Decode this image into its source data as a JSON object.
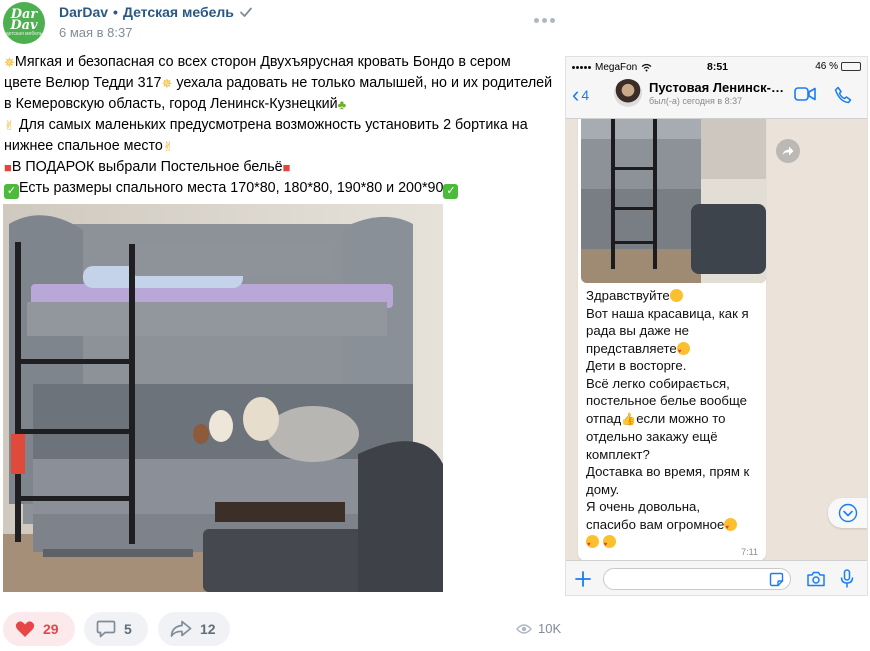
{
  "post": {
    "author_name": "DarDav",
    "separator": "•",
    "group_name": "Детская мебель",
    "avatar_logo_top": "Dar",
    "avatar_logo_bottom": "Dav",
    "avatar_logo_sub": "детская мебель",
    "date": "6 мая в 8:37",
    "text": {
      "l1": "Мягкая и безопасная со всех сторон Двухъярусная кровать Бондо в сером",
      "l2a": "цвете Велюр Тедди 317",
      "l2b": " уехала радовать не только малышей, но и их родителей",
      "l3": "в Кемеровскую область, город Ленинск-Кузнецкий",
      "l4": " Для самых маленьких предусмотрена возможность установить 2 бортика на",
      "l5": "нижнее спальное место",
      "l6": "В ПОДАРОК выбрали Постельное бельё",
      "l7": "Есть размеры спального места 170*80, 180*80, 190*80 и 200*90"
    }
  },
  "actions": {
    "likes": "29",
    "comments": "5",
    "shares": "12",
    "views": "10K"
  },
  "chat": {
    "carrier": "MegaFon",
    "time": "8:51",
    "battery": "46 %",
    "battery_level": 0.46,
    "back_count": "4",
    "contact_name": "Пустовая Ленинск-…",
    "last_seen": "был(-а) сегодня в 8:37",
    "message": {
      "l1": "Здравствуйте",
      "l2": "Вот наша красавица, как я",
      "l3": "рада вы даже не",
      "l4": "представляете",
      "l5": "Дети в восторге.",
      "l6": "Всё легко собирається,",
      "l7": "постельное белье вообще",
      "l8a": "отпад",
      "l8b": "если можно то",
      "l9": "отдельно закажу ещё",
      "l10": "комплект?",
      "l11": "Доставка во время, прям к",
      "l12": "дому.",
      "l13": "Я очень довольна,",
      "l14": "спасибо вам огромное"
    },
    "message_time": "7:11"
  },
  "colors": {
    "link": "#2a5885",
    "like": "#e64646",
    "ios_blue": "#1a7cf5",
    "checkmark": "#4cbb3c"
  }
}
